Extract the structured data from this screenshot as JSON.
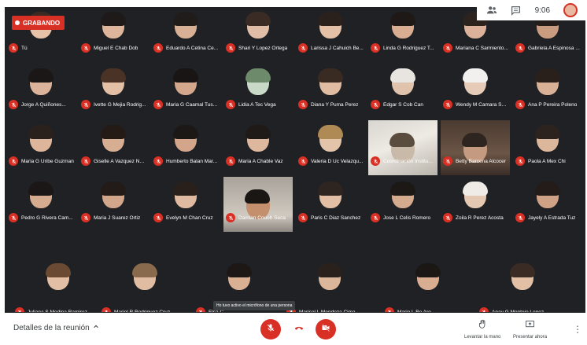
{
  "recording": {
    "label": "GRABANDO"
  },
  "topbar": {
    "time": "9:06",
    "people_icon": "people-icon",
    "chat_icon": "chat-icon"
  },
  "participants": [
    {
      "name": "Tú",
      "avatar_color": "#e6c2a8",
      "hair_color": "#3b2a22"
    },
    {
      "name": "Miguel E Chab Dob",
      "avatar_color": "#dcb59a",
      "hair_color": "#1d1a19"
    },
    {
      "name": "Eduardo A Cetina Ce...",
      "avatar_color": "#d8b095",
      "hair_color": "#201c1a"
    },
    {
      "name": "Shari Y Lopez Ortega",
      "avatar_color": "#e0bda6",
      "hair_color": "#3a2b24"
    },
    {
      "name": "Larissa J Cahuich Be...",
      "avatar_color": "#e3c0a6",
      "hair_color": "#2a211d"
    },
    {
      "name": "Linda G Rodriguez T...",
      "avatar_color": "#d9ad92",
      "hair_color": "#1e1816"
    },
    {
      "name": "Mariana C Sarmiento...",
      "avatar_color": "#dcb39a",
      "hair_color": "#2c231f"
    },
    {
      "name": "Gabriela A Espinosa ...",
      "avatar_color": "#c99c80",
      "hair_color": "#241d1a"
    },
    {
      "name": "Jorge A Quiñones...",
      "avatar_color": "#dcb49b",
      "hair_color": "#1a1716"
    },
    {
      "name": "Ivette G Mejia Rodrig...",
      "avatar_color": "#e2bfa5",
      "hair_color": "#4a3326"
    },
    {
      "name": "Maria G Caamal Tus...",
      "avatar_color": "#d4a88c",
      "hair_color": "#191514"
    },
    {
      "name": "Lidia A Tec Vega",
      "avatar_color": "#c8d9c8",
      "hair_color": "#6d8a6a"
    },
    {
      "name": "Diana Y Puma Perez",
      "avatar_color": "#e0bca2",
      "hair_color": "#3a2b22"
    },
    {
      "name": "Edgar S Cob Can",
      "avatar_color": "#dfc3ad",
      "hair_color": "#e8e4df"
    },
    {
      "name": "Wendy M Camara Sab...",
      "avatar_color": "#e6ccb8",
      "hair_color": "#f2f0ee"
    },
    {
      "name": "Ana P Pereira Poleno",
      "avatar_color": "#d9b196",
      "hair_color": "#2a201b"
    },
    {
      "name": "Maria G Uribe Guzman",
      "avatar_color": "#dcb59b",
      "hair_color": "#2b211c"
    },
    {
      "name": "Giselle A Vazquez Nor...",
      "avatar_color": "#d8ae93",
      "hair_color": "#241b17"
    },
    {
      "name": "Humberto Balan Mar...",
      "avatar_color": "#d3a58a",
      "hair_color": "#1c1816"
    },
    {
      "name": "Maria A Chable Vaz",
      "avatar_color": "#ddb89e",
      "hair_color": "#1f1a18"
    },
    {
      "name": "Valeria D Uc Velazqu...",
      "avatar_color": "#e2c4aa",
      "hair_color": "#b08a55"
    },
    {
      "name": "Coordinación Institu...",
      "avatar_color": "#c8b9a8",
      "hair_color": "#5b4c40"
    },
    {
      "name": "Betty Barcena Alcocer",
      "avatar_color": "#c49a80",
      "hair_color": "#2e2420"
    },
    {
      "name": "Paola A Mex Chi",
      "avatar_color": "#ddb79c",
      "hair_color": "#2d231e"
    },
    {
      "name": "Pedro G Rivera Cam...",
      "avatar_color": "#d6ac90",
      "hair_color": "#1b1716"
    },
    {
      "name": "Maria J Suarez Ortiz",
      "avatar_color": "#d2a68a",
      "hair_color": "#221b18"
    },
    {
      "name": "Evelyn M Chan Cruz",
      "avatar_color": "#dfbaa0",
      "hair_color": "#2a201b"
    },
    {
      "name": "Damian Couoh Seca",
      "avatar_color": "#c48f6c",
      "hair_color": "#1a1614"
    },
    {
      "name": "Paris C Diaz Sanchez",
      "avatar_color": "#e1bea4",
      "hair_color": "#2e2420"
    },
    {
      "name": "Jose L Celis Romero",
      "avatar_color": "#d5ab8f",
      "hair_color": "#1c1816"
    },
    {
      "name": "Zoila R Perez Acosta",
      "avatar_color": "#e4c8b2",
      "hair_color": "#efebe7"
    },
    {
      "name": "Jayely A Estrada Tuz",
      "avatar_color": "#cfa286",
      "hair_color": "#241c18"
    },
    {
      "name": "Juliana S Medina Ramirez",
      "avatar_color": "#e3c0a5",
      "hair_color": "#6b4a33"
    },
    {
      "name": "Mariel R Rodriguez Cruz",
      "avatar_color": "#e0bda2",
      "hair_color": "#8a6a4c"
    },
    {
      "name": "Elsa C",
      "avatar_color": "#d9b094",
      "hair_color": "#1d1816"
    },
    {
      "name": "Marisol L Mendoza Cima",
      "avatar_color": "#dcb69b",
      "hair_color": "#2a201c"
    },
    {
      "name": "Mario L Be Aro",
      "avatar_color": "#d8ad91",
      "hair_color": "#1b1715"
    },
    {
      "name": "Anay G Montejo Lopez",
      "avatar_color": "#e2c0a6",
      "hair_color": "#3a2c24"
    }
  ],
  "tooltip": {
    "text": "Ho tuvo activo el micrófono de una persona"
  },
  "bottom": {
    "details_label": "Detalles de la reunión",
    "raise_hand_label": "Levantar la mano",
    "present_label": "Presentar ahora"
  },
  "colors": {
    "accent_red": "#d93025",
    "grid_bg": "#202124"
  }
}
